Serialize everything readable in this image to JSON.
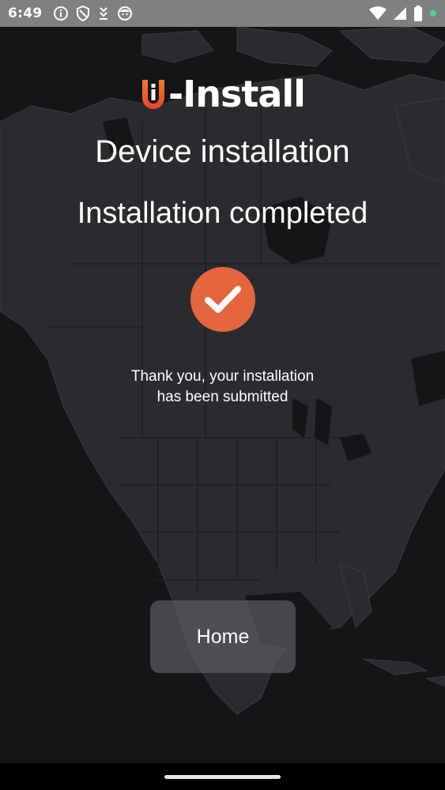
{
  "status_bar": {
    "time": "6:49",
    "left_icons": [
      "info-icon",
      "shield-icon",
      "download-icon",
      "face-icon"
    ],
    "right_icons": [
      "wifi-icon",
      "signal-icon",
      "battery-icon",
      "camera-dot-icon"
    ],
    "dot_color": "#3ddc84"
  },
  "logo": {
    "text": "-Install",
    "accent_color": "#e8612c"
  },
  "header": {
    "title": "Device installation",
    "subtitle": "Installation completed"
  },
  "status_icon": {
    "icon": "checkmark-icon",
    "color": "#e5653f"
  },
  "message": {
    "text": "Thank you, your installation has been submitted"
  },
  "actions": {
    "home_label": "Home"
  }
}
